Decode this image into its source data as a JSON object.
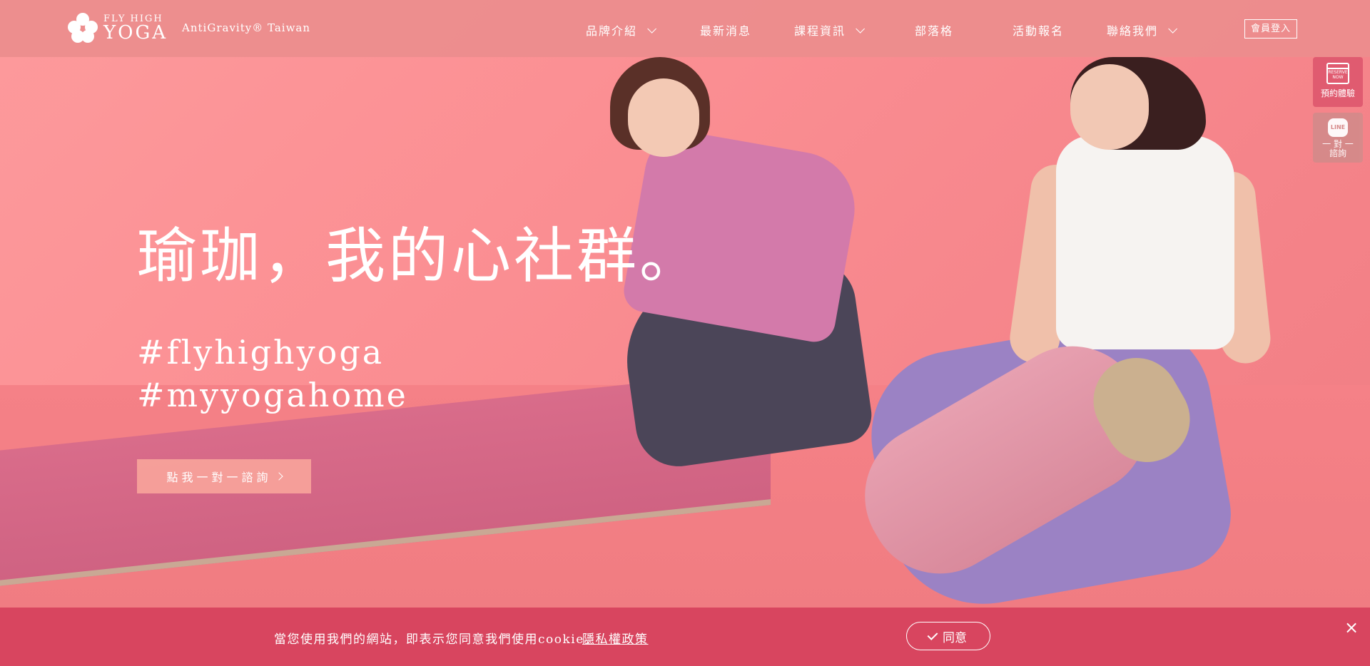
{
  "brand": {
    "logo_small": "FLY HIGH",
    "logo_big": "YOGA",
    "tagline": "AntiGravity® Taiwan"
  },
  "nav": {
    "items": [
      {
        "label": "品牌介紹",
        "has_dropdown": true
      },
      {
        "label": "最新消息",
        "has_dropdown": false
      },
      {
        "label": "課程資訊",
        "has_dropdown": true
      },
      {
        "label": "部落格",
        "has_dropdown": false
      },
      {
        "label": "活動報名",
        "has_dropdown": false
      },
      {
        "label": "聯絡我們",
        "has_dropdown": true
      }
    ],
    "login_label": "會員登入"
  },
  "side": {
    "reserve_icon_text": "RESERVE NOW",
    "reserve_label": "預約體驗",
    "line_icon_text": "LINE",
    "line_label_1": "一 對 一",
    "line_label_2": "諮詢"
  },
  "hero": {
    "title": "瑜珈，我的心社群。",
    "hashtag_1": "#flyhighyoga",
    "hashtag_2": "#myyogahome",
    "cta_label": "點我一對一諮詢"
  },
  "cookie": {
    "message": "當您使用我們的網站，即表示您同意我們使用cookie。",
    "policy_link": "隱私權政策",
    "agree_label": "同意",
    "close_icon": "×"
  },
  "colors": {
    "header_bg": "#ec8d8d",
    "hero_bg": "#fb8f93",
    "cookie_bg": "#d8455f",
    "reserve_bg": "#e05b70",
    "cta_bg": "#faa89c"
  }
}
